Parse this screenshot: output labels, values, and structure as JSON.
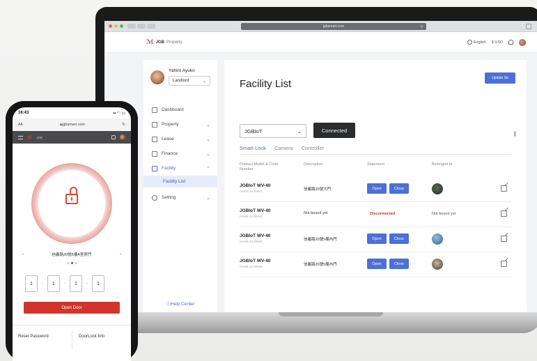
{
  "browser": {
    "url": "jgbsmart.com"
  },
  "app": {
    "brand_mark": "JGB",
    "brand_name": "JGB",
    "brand_sub": "Property",
    "language": "English",
    "currency": "$ USD"
  },
  "sidebar": {
    "user_name": "Yahiro Ayuko",
    "role": "Landlord",
    "items": [
      {
        "label": "Dashboard",
        "icon": "dashboard-icon",
        "chevron": ""
      },
      {
        "label": "Property",
        "icon": "home-icon",
        "chevron": "⌄"
      },
      {
        "label": "Lease",
        "icon": "lease-icon",
        "chevron": "⌄"
      },
      {
        "label": "Finance",
        "icon": "finance-icon",
        "chevron": "⌄"
      },
      {
        "label": "Facility",
        "icon": "facility-icon",
        "chevron": "⌃"
      },
      {
        "label": "Setting",
        "icon": "gear-icon",
        "chevron": "⌄"
      }
    ],
    "sub_item": "Facility List",
    "help": "Help Center"
  },
  "main": {
    "title": "Facility List",
    "update_button": "Update list",
    "device_select": "JGBIoT",
    "connected": "Connected",
    "tabs": [
      "Smart Lock",
      "Camera",
      "Controller"
    ],
    "headers": {
      "model": "Product Model & Code Number",
      "description": "Description",
      "statement": "Statement",
      "belonged": "Belonged to"
    },
    "rows": [
      {
        "model": "JGBIoT WV-40",
        "code": "0AWE-30-09W3",
        "description": "信義路20號大門",
        "status": "buttons",
        "open": "Open",
        "close": "Close",
        "bound": ""
      },
      {
        "model": "JGBIoT WV-40",
        "code": "0AWE-22-59W0",
        "description": "Not bound yet",
        "status": "Disconnected",
        "open": "",
        "close": "",
        "bound": "Not bound yet"
      },
      {
        "model": "JGBIoT WV-40",
        "code": "0AWE-22-59W0",
        "description": "信義路20號5樓內門",
        "status": "buttons",
        "open": "Open",
        "close": "Close",
        "bound": ""
      },
      {
        "model": "JGBIoT WV-40",
        "code": "0AWE-22-59W0",
        "description": "信義路20號5樓內門",
        "status": "buttons",
        "open": "Open",
        "close": "Close",
        "bound": ""
      }
    ]
  },
  "phone": {
    "time": "16:43",
    "aa": "AA",
    "url": "jgbsmart.com",
    "brand": "JGB",
    "door_name": "信義路20號5樓A室房門",
    "pins": [
      "1",
      "1",
      "1",
      "1"
    ],
    "open_door": "Open Door",
    "reset_password": "Reset Password",
    "doorlock_info": "DoorLock Info"
  },
  "colors": {
    "accent": "#4d6fd6",
    "brand_red": "#c8302b"
  }
}
